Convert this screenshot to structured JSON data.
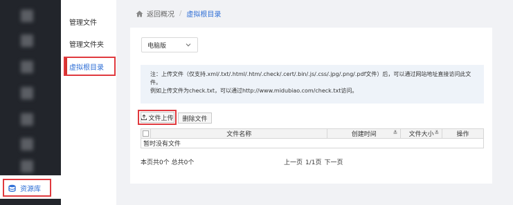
{
  "rail": {
    "resource_label": "资源库"
  },
  "submenu": {
    "items": [
      {
        "label": "管理文件"
      },
      {
        "label": "管理文件夹"
      },
      {
        "label": "虚拟根目录"
      }
    ]
  },
  "breadcrumb": {
    "back_label": "返回概况",
    "separator": "/",
    "current": "虚拟根目录"
  },
  "platform_select": {
    "value": "电脑版"
  },
  "note": {
    "line1": "注：上传文件（仅支持.xml/.txt/.html/.htm/.check/.cert/.bin/.js/.css/.jpg/.png/.pdf文件）后，可以通过网站地址直接访问此文件。",
    "line2": "例如上传文件为check.txt，可以通过http://www.midubiao.com/check.txt访问。"
  },
  "toolbar": {
    "upload_label": "文件上传",
    "delete_label": "删除文件"
  },
  "table": {
    "columns": [
      "文件名称",
      "创建时间",
      "文件大小",
      "操作"
    ],
    "empty_text": "暂时没有文件"
  },
  "pagination": {
    "summary": "本页共0个 总共0个",
    "prev": "上一页",
    "page": "1/1页",
    "next": "下一页"
  },
  "colors": {
    "accent_blue": "#2f6fd6",
    "highlight_red": "#e0393e",
    "rail_dark": "#22252b"
  }
}
